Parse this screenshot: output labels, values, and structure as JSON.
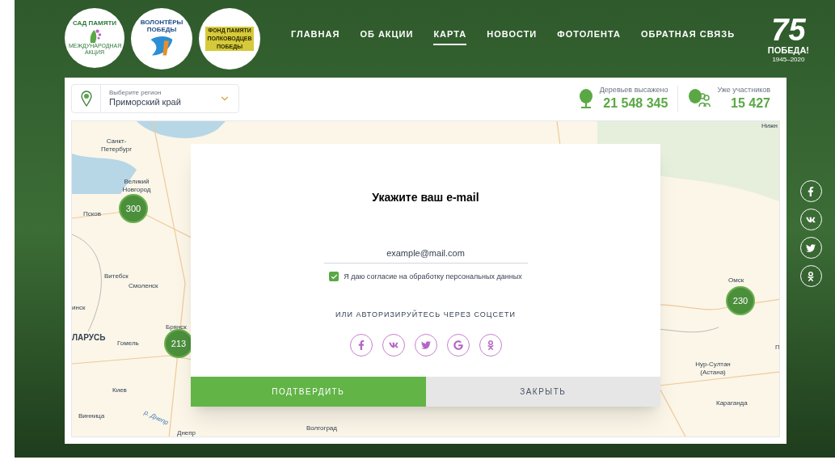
{
  "header": {
    "logos": [
      {
        "kind": "garden",
        "text": "САД ПАМЯТИ",
        "subtext": "МЕЖДУНАРОДНАЯ АКЦИЯ"
      },
      {
        "kind": "volunteers",
        "text": "ВОЛОНТЁРЫ ПОБЕДЫ"
      },
      {
        "kind": "fund",
        "text": "ФОНД ПАМЯТИ ПОЛКОВОДЦЕВ ПОБЕДЫ"
      }
    ],
    "nav": [
      {
        "label": "ГЛАВНАЯ",
        "selected": false
      },
      {
        "label": "ОБ АКЦИИ",
        "selected": false
      },
      {
        "label": "КАРТА",
        "selected": true
      },
      {
        "label": "НОВОСТИ",
        "selected": false
      },
      {
        "label": "ФОТОЛЕНТА",
        "selected": false
      },
      {
        "label": "ОБРАТНАЯ СВЯЗЬ",
        "selected": false
      }
    ],
    "anniversary": {
      "number": "75",
      "title": "ПОБЕДА!",
      "years": "1945–2020"
    }
  },
  "region_select": {
    "label": "Выберите регион",
    "value": "Приморский край"
  },
  "stats": [
    {
      "kind": "trees",
      "label": "Деревьев высажено",
      "value": "21 548 345"
    },
    {
      "kind": "people",
      "label": "Уже участников",
      "value": "15 427"
    }
  ],
  "map": {
    "labels": [
      {
        "text": "Нижн",
        "kind": "city"
      },
      {
        "text": "Санкт-Петербург",
        "kind": "city"
      },
      {
        "text": "Великий Новгород",
        "kind": "city"
      },
      {
        "text": "Псков",
        "kind": "city"
      },
      {
        "text": "Витебск",
        "kind": "city"
      },
      {
        "text": "Смоленск",
        "kind": "city"
      },
      {
        "text": "инск",
        "kind": "city"
      },
      {
        "text": "ЛАРУСЬ",
        "kind": "country"
      },
      {
        "text": "Гомель",
        "kind": "city"
      },
      {
        "text": "Брянск",
        "kind": "city"
      },
      {
        "text": "Киев",
        "kind": "city"
      },
      {
        "text": "Винница",
        "kind": "city"
      },
      {
        "text": "р. Днепр",
        "kind": "river"
      },
      {
        "text": "Днепр",
        "kind": "city"
      },
      {
        "text": "Волгоград",
        "kind": "city"
      },
      {
        "text": "Омск",
        "kind": "city"
      },
      {
        "text": "П",
        "kind": "city"
      },
      {
        "text": "Нур-Султан (Астана)",
        "kind": "city"
      },
      {
        "text": "Караганда",
        "kind": "city"
      }
    ],
    "clusters": [
      {
        "count": "300"
      },
      {
        "count": "213"
      },
      {
        "count": "230"
      }
    ]
  },
  "modal": {
    "title": "Укажите ваш e-mail",
    "email": {
      "placeholder": "example@mail.com"
    },
    "consent": {
      "label": "Я даю согласие на обработку персональных данных",
      "checked": true
    },
    "social_heading": "ИЛИ АВТОРИЗИРУЙТЕСЬ ЧЕРЕЗ СОЦСЕТИ",
    "social": [
      {
        "kind": "facebook"
      },
      {
        "kind": "vk"
      },
      {
        "kind": "twitter"
      },
      {
        "kind": "google"
      },
      {
        "kind": "ok"
      }
    ],
    "buttons": [
      {
        "label": "ПОДТВЕРДИТЬ",
        "kind": "primary"
      },
      {
        "label": "ЗАКРЫТЬ",
        "kind": "secondary"
      }
    ]
  },
  "side_social": [
    {
      "kind": "facebook"
    },
    {
      "kind": "vk"
    },
    {
      "kind": "twitter"
    },
    {
      "kind": "ok"
    }
  ]
}
